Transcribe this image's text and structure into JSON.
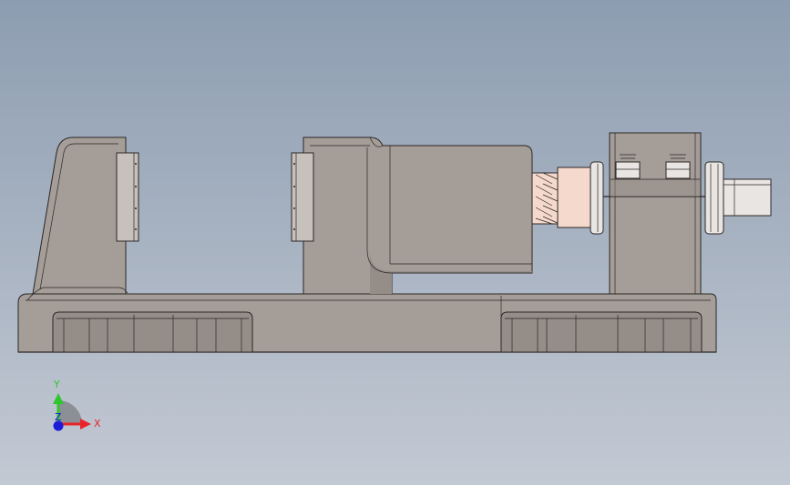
{
  "viewport": {
    "background_top": "#8d9db1",
    "background_bottom": "#c3c9d3"
  },
  "part_colors": {
    "body": "#a59d97",
    "body_dark": "#958d87",
    "edge": "#2a2624",
    "jaw_pad": "#c7c1bc",
    "spring": "#f5d9cc",
    "nut": "#e9e5e2"
  },
  "triad": {
    "x_label": "X",
    "y_label": "Y",
    "z_label": "Z",
    "x_color": "#e8242b",
    "y_color": "#2fc630",
    "z_color": "#1b1bd9"
  }
}
